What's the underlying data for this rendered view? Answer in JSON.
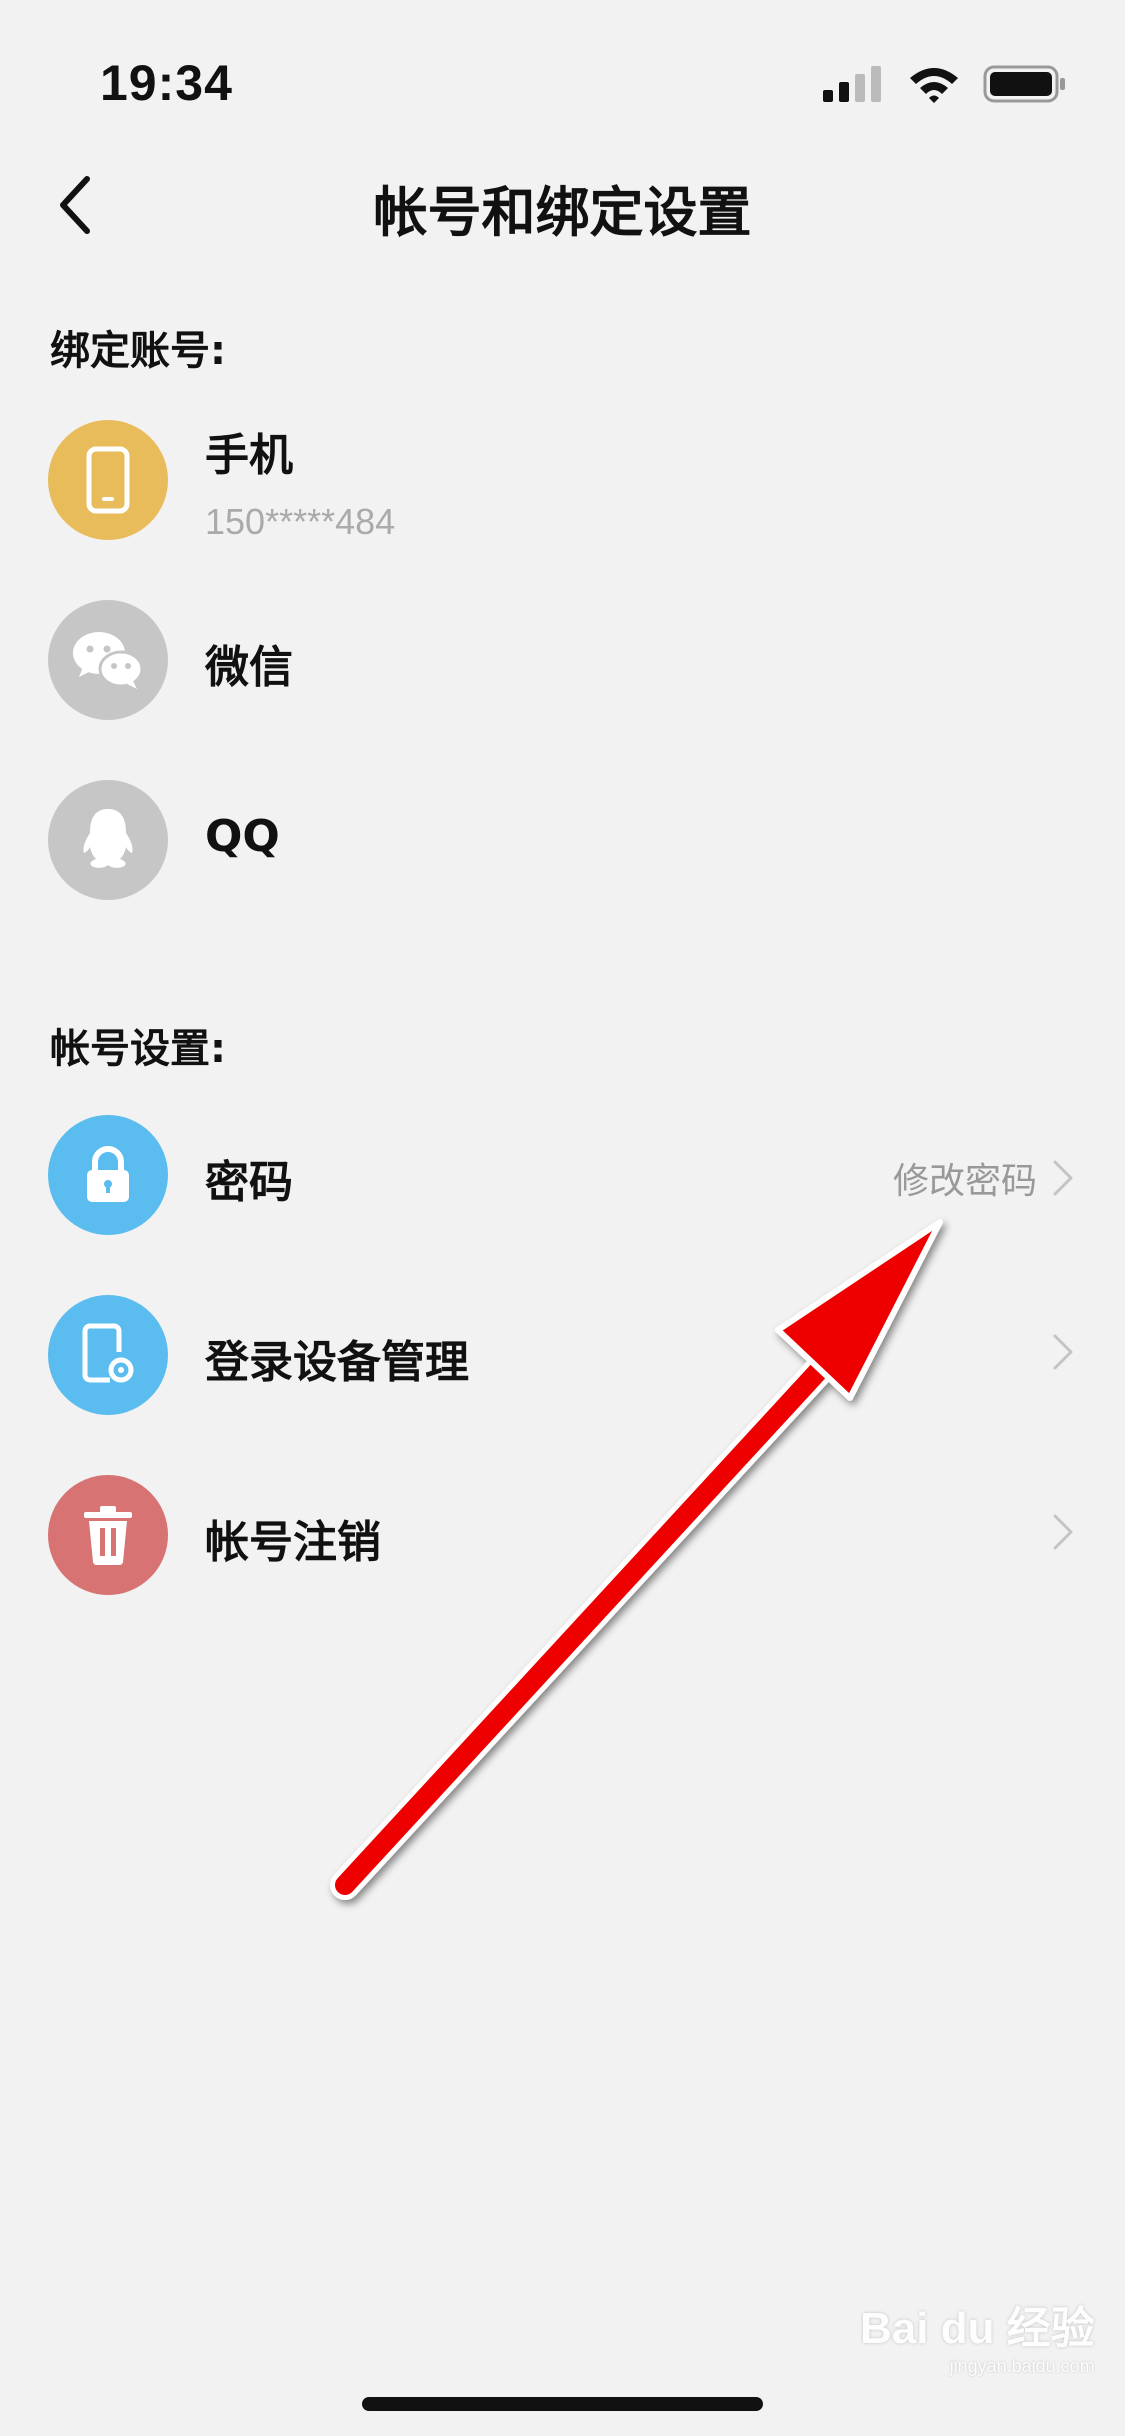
{
  "status_bar": {
    "time": "19:34"
  },
  "header": {
    "title": "帐号和绑定设置"
  },
  "bound_accounts": {
    "title": "绑定账号:",
    "items": [
      {
        "label": "手机",
        "sub": "150*****484",
        "icon": "phone-icon",
        "color": "#e8bc5a"
      },
      {
        "label": "微信",
        "icon": "wechat-icon",
        "color": "#c6c6c6"
      },
      {
        "label": "QQ",
        "icon": "qq-icon",
        "color": "#c6c6c6"
      }
    ]
  },
  "account_settings": {
    "title": "帐号设置:",
    "items": [
      {
        "label": "密码",
        "action": "修改密码",
        "icon": "lock-icon",
        "color": "#5bbcef"
      },
      {
        "label": "登录设备管理",
        "icon": "device-settings-icon",
        "color": "#5bbcef"
      },
      {
        "label": "帐号注销",
        "icon": "trash-icon",
        "color": "#d77373"
      }
    ]
  },
  "watermark": {
    "brand": "Bai du 经验",
    "url": "jingyan.baidu.com"
  }
}
